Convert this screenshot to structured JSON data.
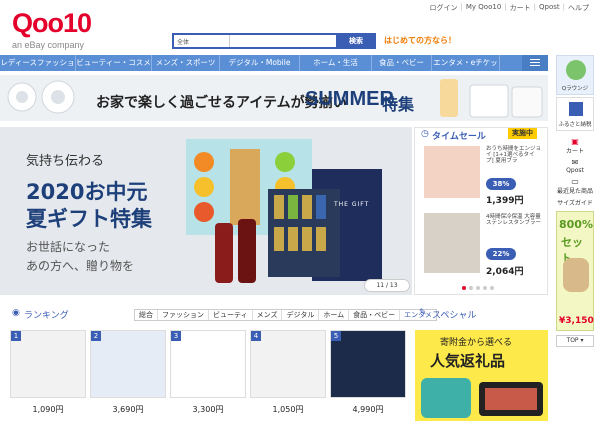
{
  "brand": {
    "name": "Qoo10",
    "sub": "an eBay company",
    "logo_color": "#e4002b"
  },
  "top_links": [
    "ログイン",
    "My Qoo10",
    "カート",
    "Qpost",
    "ヘルプ"
  ],
  "search": {
    "category": "全体",
    "button": "検索"
  },
  "first_time": "はじめての方なら！",
  "nav": [
    "レディースファッション",
    "ビューティー・コスメ",
    "メンズ・スポーツ",
    "デジタル・Mobile",
    "ホーム・生活",
    "食品・ベビー",
    "エンタメ・eチケット"
  ],
  "summer": {
    "text": "お家で楽しく過ごせるアイテムが勢揃い",
    "big": "SUMMER",
    "big2": "特集"
  },
  "hero": {
    "sub": "気持ち伝わる",
    "year": "2020お中元",
    "title": "夏ギフト特集",
    "desc1": "お世話になった",
    "desc2": "あの方へ、贈り物を",
    "pager": "11 / 13",
    "box_label": "THE GIFT"
  },
  "timesale": {
    "title": "タイムセール",
    "badge": "実施中",
    "items": [
      {
        "desc": "おうち時間をエンジョイ [1+1選べるタイプ] 夏用ブラ",
        "pct": "38%",
        "price": "1,399円"
      },
      {
        "desc": "4時間保冷保温 大容量ステンレスタンブラー",
        "pct": "22%",
        "price": "2,064円"
      }
    ]
  },
  "side": {
    "items": [
      "Qラウンジ",
      "ふるさと納税",
      "カート",
      "Qpost",
      "最近見た商品",
      "サイズガイド"
    ],
    "ad_big": "800%",
    "ad_sub": "セット",
    "price": "¥3,150",
    "top": "TOP"
  },
  "ranking": {
    "title": "ランキング",
    "tabs": [
      "総合",
      "ファッション",
      "ビューティ",
      "メンズ",
      "デジタル",
      "ホーム",
      "食品・ベビー",
      "エンタメ"
    ],
    "products": [
      {
        "num": "1",
        "price": "1,090円"
      },
      {
        "num": "2",
        "price": "3,690円"
      },
      {
        "num": "3",
        "price": "3,300円"
      },
      {
        "num": "4",
        "price": "1,050円"
      },
      {
        "num": "5",
        "price": "4,990円"
      }
    ]
  },
  "special": {
    "title": "スペシャル",
    "line1": "寄附金から選べる",
    "line2": "人気返礼品"
  }
}
